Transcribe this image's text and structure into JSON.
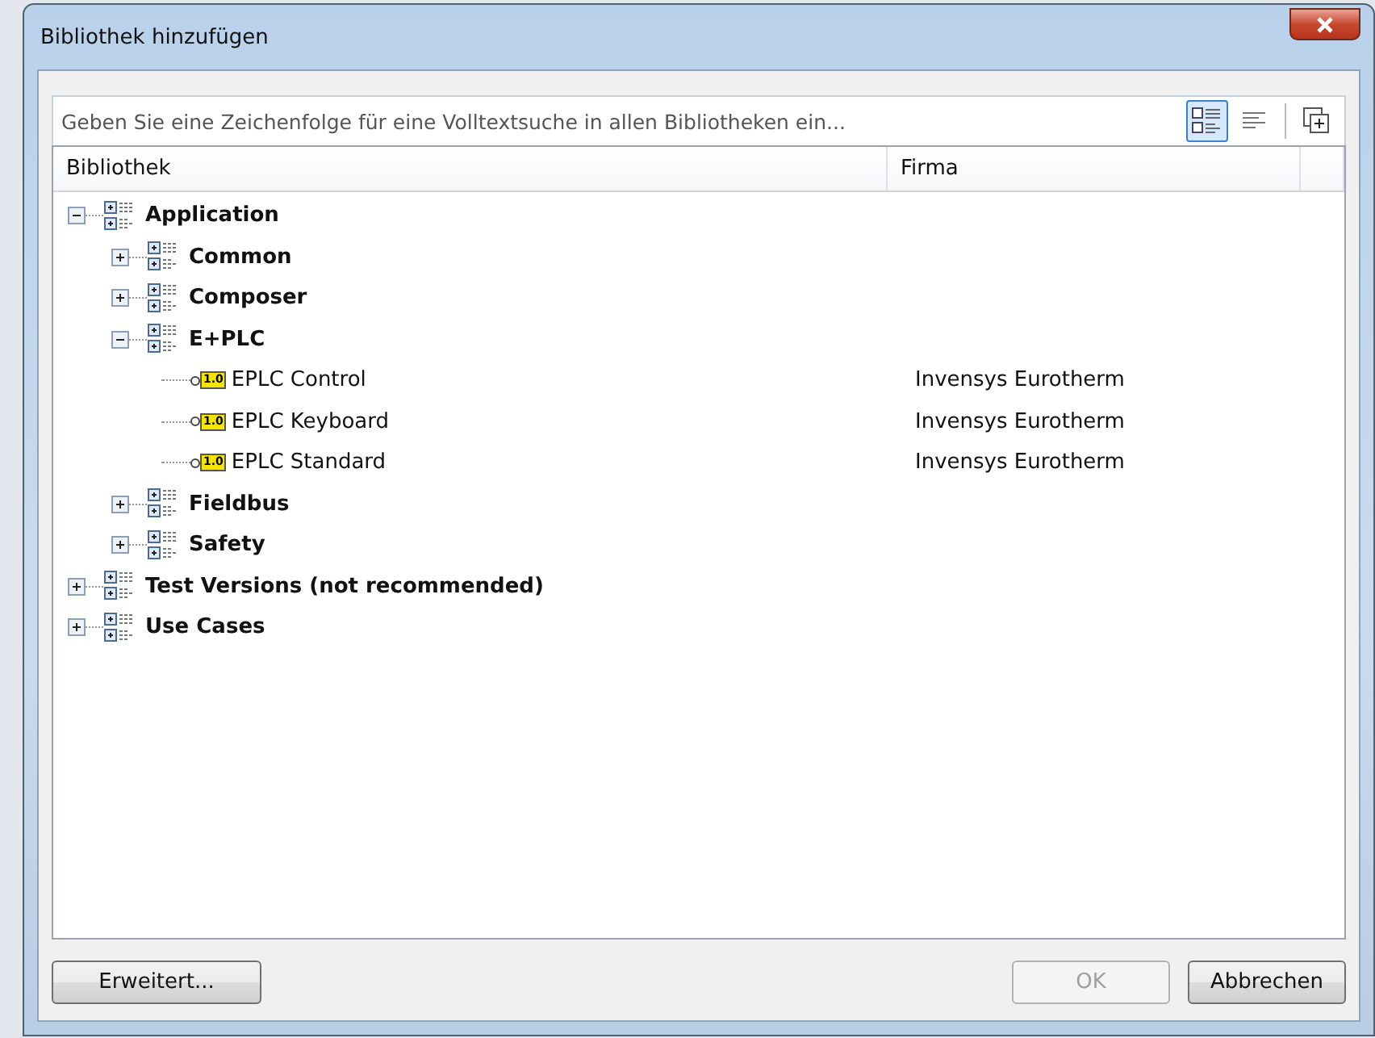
{
  "window": {
    "title": "Bibliothek hinzufügen"
  },
  "search": {
    "placeholder": "Geben Sie eine Zeichenfolge für eine Volltextsuche in allen Bibliotheken ein..."
  },
  "view_buttons": [
    {
      "kind": "tree",
      "selected": true
    },
    {
      "kind": "list",
      "selected": false
    },
    {
      "kind": "add",
      "selected": false
    }
  ],
  "table": {
    "columns": [
      "Bibliothek",
      "Firma"
    ],
    "tree": [
      {
        "kind": "folder",
        "name": "Application",
        "expanded": true,
        "children": [
          {
            "kind": "folder",
            "name": "Common",
            "expanded": false
          },
          {
            "kind": "folder",
            "name": "Composer",
            "expanded": false
          },
          {
            "kind": "folder",
            "name": "E+PLC",
            "expanded": true,
            "children": [
              {
                "kind": "library",
                "name": "EPLC Control",
                "version": "1.0",
                "company": "Invensys Eurotherm"
              },
              {
                "kind": "library",
                "name": "EPLC Keyboard",
                "version": "1.0",
                "company": "Invensys Eurotherm"
              },
              {
                "kind": "library",
                "name": "EPLC Standard",
                "version": "1.0",
                "company": "Invensys Eurotherm"
              }
            ]
          },
          {
            "kind": "folder",
            "name": "Fieldbus",
            "expanded": false
          },
          {
            "kind": "folder",
            "name": "Safety",
            "expanded": false
          }
        ]
      },
      {
        "kind": "folder",
        "name": "Test Versions (not recommended)",
        "expanded": false
      },
      {
        "kind": "folder",
        "name": "Use Cases",
        "expanded": false
      }
    ]
  },
  "buttons": [
    {
      "label": "Erweitert...",
      "disabled": false
    },
    {
      "label": "OK",
      "disabled": true
    },
    {
      "label": "Abbrechen",
      "disabled": false
    }
  ]
}
